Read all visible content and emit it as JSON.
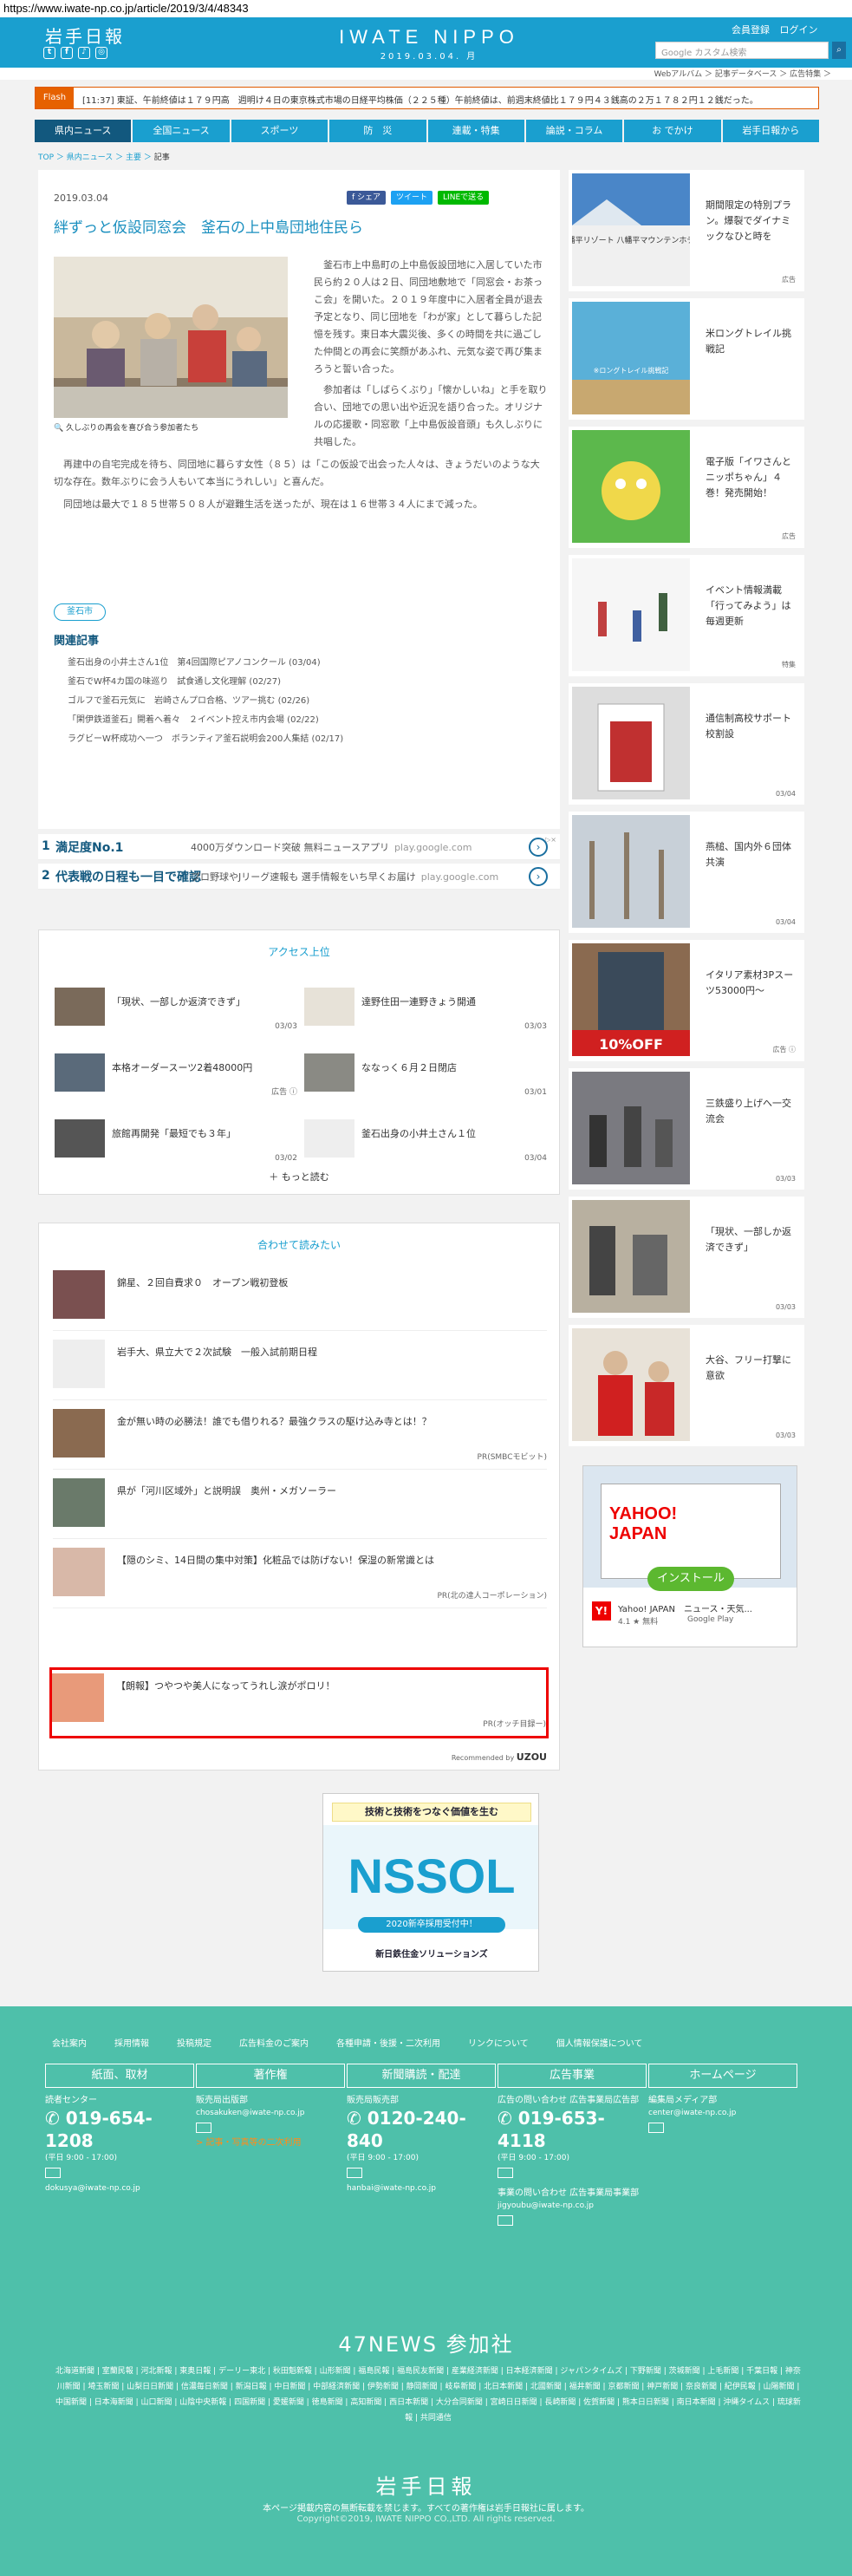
{
  "browser": {
    "url": "https://www.iwate-np.co.jp/article/2019/3/4/48343"
  },
  "header": {
    "logo": "岩手日報",
    "center_title": "IWATE NIPPO",
    "center_date": "2019.03.04. 月",
    "member": "会員登録",
    "login": "ログイン",
    "search_placeholder": "Google カスタム検索",
    "sub_links": "Webアルバム ＞ 記事データベース ＞ 広告特集 ＞"
  },
  "flash": {
    "label": "Flash",
    "text": "[11:37] 東証、午前終値は１７９円高　週明け４日の東京株式市場の日経平均株価（２２５種）午前終値は、前週末終値比１７９円４３銭高の２万１７８２円１２銭だった。"
  },
  "nav": [
    "県内ニュース",
    "全国ニュース",
    "スポーツ",
    "防　災",
    "連載・特集",
    "論説・コラム",
    "お でかけ",
    "岩手日報から"
  ],
  "breadcrumb": {
    "top": "TOP",
    "news": "県内ニュース",
    "section": "主要",
    "current": "記事"
  },
  "article": {
    "date": "2019.03.04",
    "share": [
      "f シェア",
      "ツイート",
      "LINEで送る"
    ],
    "title": "絆ずっと仮設同窓会　釜石の上中島団地住民ら",
    "caption": "久しぶりの再会を喜び合う参加者たち",
    "p1": "釜石市上中島町の上中島仮設団地に入居していた市民ら約２０人は２日、同団地敷地で「同窓会・お茶っこ会」を開いた。２０１９年度中に入居者全員が退去予定となり、同じ団地を「わが家」として暮らした記憶を残す。東日本大震災後、多くの時間を共に過ごした仲間との再会に笑顔があふれ、元気な姿で再び集まろうと誓い合った。",
    "p2": "参加者は「しばらくぶり」「懐かしいね」と手を取り合い、団地での思い出や近況を語り合った。オリジナルの応援歌・同窓歌「上中島仮設音頭」も久しぶりに共唱した。",
    "p3": "再建中の自宅完成を待ち、同団地に暮らす女性（８５）は「この仮設で出会った人々は、きょうだいのような大切な存在。数年ぶりに会う人もいて本当にうれしい」と喜んだ。",
    "p4": "同団地は最大で１８５世帯５０８人が避難生活を送ったが、現在は１６世帯３４人にまで減った。",
    "tag": "釜石市",
    "related_title": "関連記事",
    "related": [
      "釜石出身の小井土さん1位　第4回国際ピアノコンクール (03/04)",
      "釜石でW杯4カ国の味巡り　試食通し文化理解 (02/27)",
      "ゴルフで釜石元気に　岩崎さんプロ合格、ツアー挑む (02/26)",
      "「閑伊鉄道釜石」開着へ着々　２イベント控え市内会場 (02/22)",
      "ラグビーW杯成功へ一つ　ボランティア釜石説明会200人集結 (02/17)"
    ]
  },
  "rank_ads": [
    {
      "n": "1",
      "headline": "満足度No.1",
      "desc": "4000万ダウンロード突破 無料ニュースアプリ",
      "url": "play.google.com"
    },
    {
      "n": "2",
      "headline": "代表戦の日程も一目で確認",
      "desc": "プロ野球やJリーグ速報も 選手情報をいち早くお届け",
      "url": "play.google.com"
    }
  ],
  "access": {
    "title": "アクセス上位",
    "items": [
      {
        "title": "「現状、一部しか返済できず」",
        "date": "03/03"
      },
      {
        "title": "達野住田一連野きょう開通",
        "date": "03/03"
      },
      {
        "title": "本格オーダースーツ2着48000円",
        "date": "広告 ⓘ"
      },
      {
        "title": "ななっく６月２日閉店",
        "date": "03/01"
      },
      {
        "title": "旅館再開発「最短でも３年」",
        "date": "03/02"
      },
      {
        "title": "釜石出身の小井土さん１位",
        "date": "03/04"
      }
    ],
    "more": "＋ もっと読む"
  },
  "recommend": {
    "title": "合わせて読みたい",
    "items": [
      {
        "title": "錦星、２回自費求０　オープン戦初登板",
        "pr": ""
      },
      {
        "title": "岩手大、県立大で２次試験　一般入試前期日程",
        "pr": ""
      },
      {
        "title": "金が無い時の必勝法！誰でも借りれる？最強クラスの駆け込み寺とは！？",
        "pr": "PR(SMBCモビット)"
      },
      {
        "title": "県が「河川区域外」と説明誤　奥州・メガソーラー",
        "pr": ""
      },
      {
        "title": "【隠のシミ、14日間の集中対策】化粧品では防げない！保湿の新常識とは",
        "pr": "PR(北の達人コーポレーション)"
      },
      {
        "title": "【朗報】つやつや美人になってうれし涙がポロリ！",
        "pr": "PR(オッチ目録ー)"
      }
    ],
    "credit": "Recommended by",
    "credit_brand": "UZOU"
  },
  "bottom_ad": {
    "tag": "技術と技術をつなぐ価値を生む",
    "logo": "NSSOL",
    "recruit": "2020新卒採用受付中！",
    "company": "新日鉄住金ソリューションズ"
  },
  "side": [
    {
      "title": "期間限定の特別プラン。爆裂でダイナミックなひと時を",
      "label": "広告",
      "photo": "八幡平リゾート 八幡平マウンテンホテル"
    },
    {
      "title": "米ロングトレイル挑戦記",
      "label": "",
      "photo": "※ロングトレイル挑戦記"
    },
    {
      "title": "電子版「イワさんとニッポちゃん」４巻！発売開始！",
      "label": "広告",
      "photo": ""
    },
    {
      "title": "イベント情報満載「行ってみよう」は毎週更新",
      "label": "特集",
      "photo": ""
    },
    {
      "title": "通信制高校サポート校割設",
      "label": "03/04",
      "photo": ""
    },
    {
      "title": "燕槌、国内外６団体共演",
      "label": "03/04",
      "photo": ""
    },
    {
      "title": "イタリア素材3Pスーツ53000円〜",
      "label": "広告 ⓘ",
      "photo": "10%OFF"
    },
    {
      "title": "三鉄盛り上げへ一交流会",
      "label": "03/03",
      "photo": ""
    },
    {
      "title": "「現状、一部しか返済できず」",
      "label": "03/03",
      "photo": ""
    },
    {
      "title": "大谷、フリー打撃に意欲",
      "label": "03/03",
      "photo": ""
    }
  ],
  "yahoo_ad": {
    "brand": "YAHOO! JAPAN",
    "install": "インストール",
    "app": "Yahoo! JAPAN　ニュース・天気...",
    "rating": "4.1 ★ 無料",
    "store": "Google Play"
  },
  "footer": {
    "links": [
      "会社案内",
      "採用情報",
      "投稿規定",
      "広告料金のご案内",
      "各種申請・後援・二次利用",
      "リンクについて",
      "個人情報保護について"
    ],
    "cols": [
      {
        "head": "紙面、取材",
        "l1": "読者センター",
        "phone": "019-654-1208",
        "hours": "(平日 9:00 - 17:00)",
        "mail": "dokusya@iwate-np.co.jp",
        "extra": ""
      },
      {
        "head": "著作権",
        "l1": "販売局出版部",
        "phone": "",
        "hours": "",
        "mail": "chosakuken@iwate-np.co.jp",
        "extra": "> 記事・写真等の二次利用"
      },
      {
        "head": "新聞購読・配達",
        "l1": "販売局販売部",
        "phone": "0120-240-840",
        "hours": "(平日 9:00 - 17:00)",
        "mail": "hanbai@iwate-np.co.jp",
        "extra": ""
      },
      {
        "head": "広告事業",
        "l1": "広告の問い合わせ 広告事業局広告部",
        "phone": "019-653-4118",
        "hours": "(平日 9:00 - 17:00)",
        "mail": "事業の問い合わせ 広告事業局事業部",
        "extra": "jigyoubu@iwate-np.co.jp"
      },
      {
        "head": "ホームページ",
        "l1": "編集局メディア部",
        "phone": "",
        "hours": "",
        "mail": "center@iwate-np.co.jp",
        "extra": ""
      }
    ],
    "news47": "47NEWS 参加社",
    "papers": "北海道新聞 | 室蘭民報 | 河北新報 | 東奥日報 | デーリー東北 | 秋田魁新報 | 山形新聞 | 福島民報 | 福島民友新聞 | 産業経済新聞 | 日本経済新聞 | ジャパンタイムズ | 下野新聞 | 茨城新聞 | 上毛新聞 | 千葉日報 | 神奈川新聞 | 埼玉新聞 | 山梨日日新聞 | 信濃毎日新聞 | 新潟日報 | 中日新聞 | 中部経済新聞 | 伊勢新聞 | 静岡新聞 | 岐阜新聞 | 北日本新聞 | 北國新聞 | 福井新聞 | 京都新聞 | 神戸新聞 | 奈良新聞 | 紀伊民報 | 山陽新聞 | 中国新聞 | 日本海新聞 | 山口新聞 | 山陰中央新報 | 四国新聞 | 愛媛新聞 | 徳島新聞 | 高知新聞 | 西日本新聞 | 大分合同新聞 | 宮崎日日新聞 | 長崎新聞 | 佐賀新聞 | 熊本日日新聞 | 南日本新聞 | 沖縄タイムス | 琉球新報 | 共同通信",
    "logo": "岩手日報",
    "note": "本ページ掲載内容の無断転載を禁じます。すべての著作権は岩手日報社に属します。",
    "copy": "Copyright©2019, IWATE NIPPO CO.,LTD. All rights reserved."
  }
}
